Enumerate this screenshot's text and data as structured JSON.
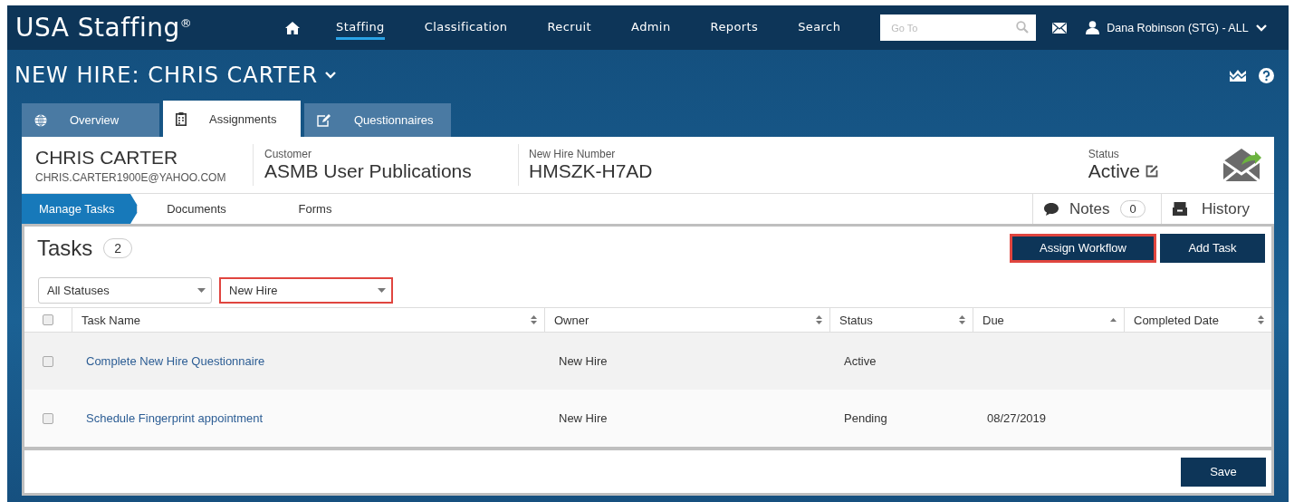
{
  "app_title": "USA Staffing",
  "registered_mark": "®",
  "nav": {
    "items": [
      {
        "label": "Staffing",
        "selected": true
      },
      {
        "label": "Classification",
        "selected": false
      },
      {
        "label": "Recruit",
        "selected": false
      },
      {
        "label": "Admin",
        "selected": false
      },
      {
        "label": "Reports",
        "selected": false
      },
      {
        "label": "Search",
        "selected": false
      }
    ],
    "goto": {
      "placeholder": "Go To"
    },
    "user": "Dana Robinson (STG) - ALL"
  },
  "page_title": "NEW HIRE: CHRIS CARTER",
  "tabs": [
    {
      "label": "Overview",
      "selected": false,
      "kind": "globe"
    },
    {
      "label": "Assignments",
      "selected": true,
      "kind": "clipboard"
    },
    {
      "label": "Questionnaires",
      "selected": false,
      "kind": "edit"
    }
  ],
  "person": {
    "name": "CHRIS CARTER",
    "email": "CHRIS.CARTER1900E@YAHOO.COM"
  },
  "customer": {
    "label": "Customer",
    "value": "ASMB User Publications"
  },
  "new_hire_number": {
    "label": "New Hire Number",
    "value": "HMSZK-H7AD"
  },
  "status": {
    "label": "Status",
    "value": "Active"
  },
  "steps": [
    {
      "label": "Manage Tasks",
      "selected": true
    },
    {
      "label": "Documents",
      "selected": false
    },
    {
      "label": "Forms",
      "selected": false
    }
  ],
  "notes": {
    "label": "Notes",
    "count": "0"
  },
  "history": "History",
  "tasks": {
    "title": "Tasks",
    "count": "2"
  },
  "buttons": [
    {
      "label": "Assign Workflow",
      "highlighted": true
    },
    {
      "label": "Add Task",
      "highlighted": false
    }
  ],
  "filters": [
    {
      "value": "All Statuses",
      "highlighted": false
    },
    {
      "value": "New Hire",
      "highlighted": true
    }
  ],
  "table": {
    "header_checked": false,
    "columns": [
      {
        "label": "Task Name",
        "sorted": false
      },
      {
        "label": "Owner",
        "sorted": false
      },
      {
        "label": "Status",
        "sorted": false
      },
      {
        "label": "Due",
        "sorted": true
      },
      {
        "label": "Completed Date",
        "sorted": false
      }
    ],
    "rows": [
      {
        "checked": false,
        "task": "Complete New Hire Questionnaire",
        "owner": "New Hire",
        "status": "Active"
      },
      {
        "checked": false,
        "task": "Schedule Fingerprint appointment",
        "owner": "New Hire",
        "status": "Pending",
        "due": "08/27/2019"
      }
    ]
  },
  "save": "Save"
}
